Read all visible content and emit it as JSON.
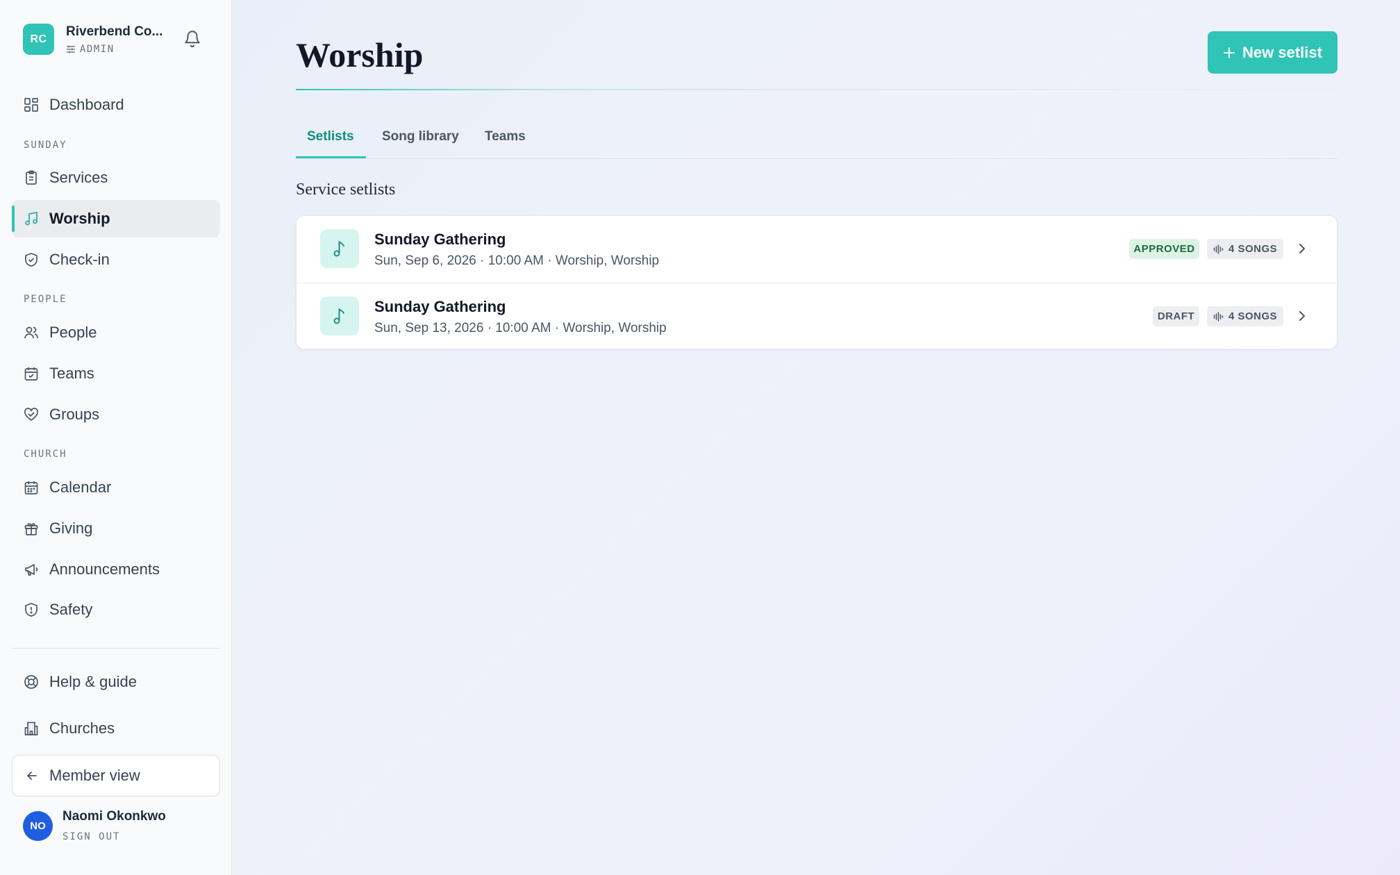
{
  "org": {
    "initials": "RC",
    "name": "Riverbend Co...",
    "role": "ADMIN"
  },
  "nav": {
    "dashboard": "Dashboard",
    "section_sunday": "SUNDAY",
    "services": "Services",
    "worship": "Worship",
    "checkin": "Check-in",
    "section_people": "PEOPLE",
    "people": "People",
    "teams": "Teams",
    "groups": "Groups",
    "section_church": "CHURCH",
    "calendar": "Calendar",
    "giving": "Giving",
    "announcements": "Announcements",
    "safety": "Safety",
    "help": "Help & guide",
    "churches": "Churches",
    "member_view": "Member view",
    "active": "worship"
  },
  "user": {
    "initials": "NO",
    "name": "Naomi Okonkwo",
    "signout": "SIGN OUT"
  },
  "page": {
    "title": "Worship",
    "new_button": "New setlist"
  },
  "tabs": [
    "Setlists",
    "Song library",
    "Teams"
  ],
  "active_tab": "Setlists",
  "section_title": "Service setlists",
  "setlists": [
    {
      "title": "Sunday Gathering",
      "subtitle": "Sun, Sep 6, 2026 · 10:00 AM · Worship, Worship",
      "status": "APPROVED",
      "songs": "4 SONGS"
    },
    {
      "title": "Sunday Gathering",
      "subtitle": "Sun, Sep 13, 2026 · 10:00 AM · Worship, Worship",
      "status": "DRAFT",
      "songs": "4 SONGS"
    }
  ],
  "colors": {
    "accent": "#2fc4b6",
    "avatar": "#1f5ee0",
    "approved_bg": "#dcf3e5",
    "approved_text": "#1c6b3c"
  }
}
